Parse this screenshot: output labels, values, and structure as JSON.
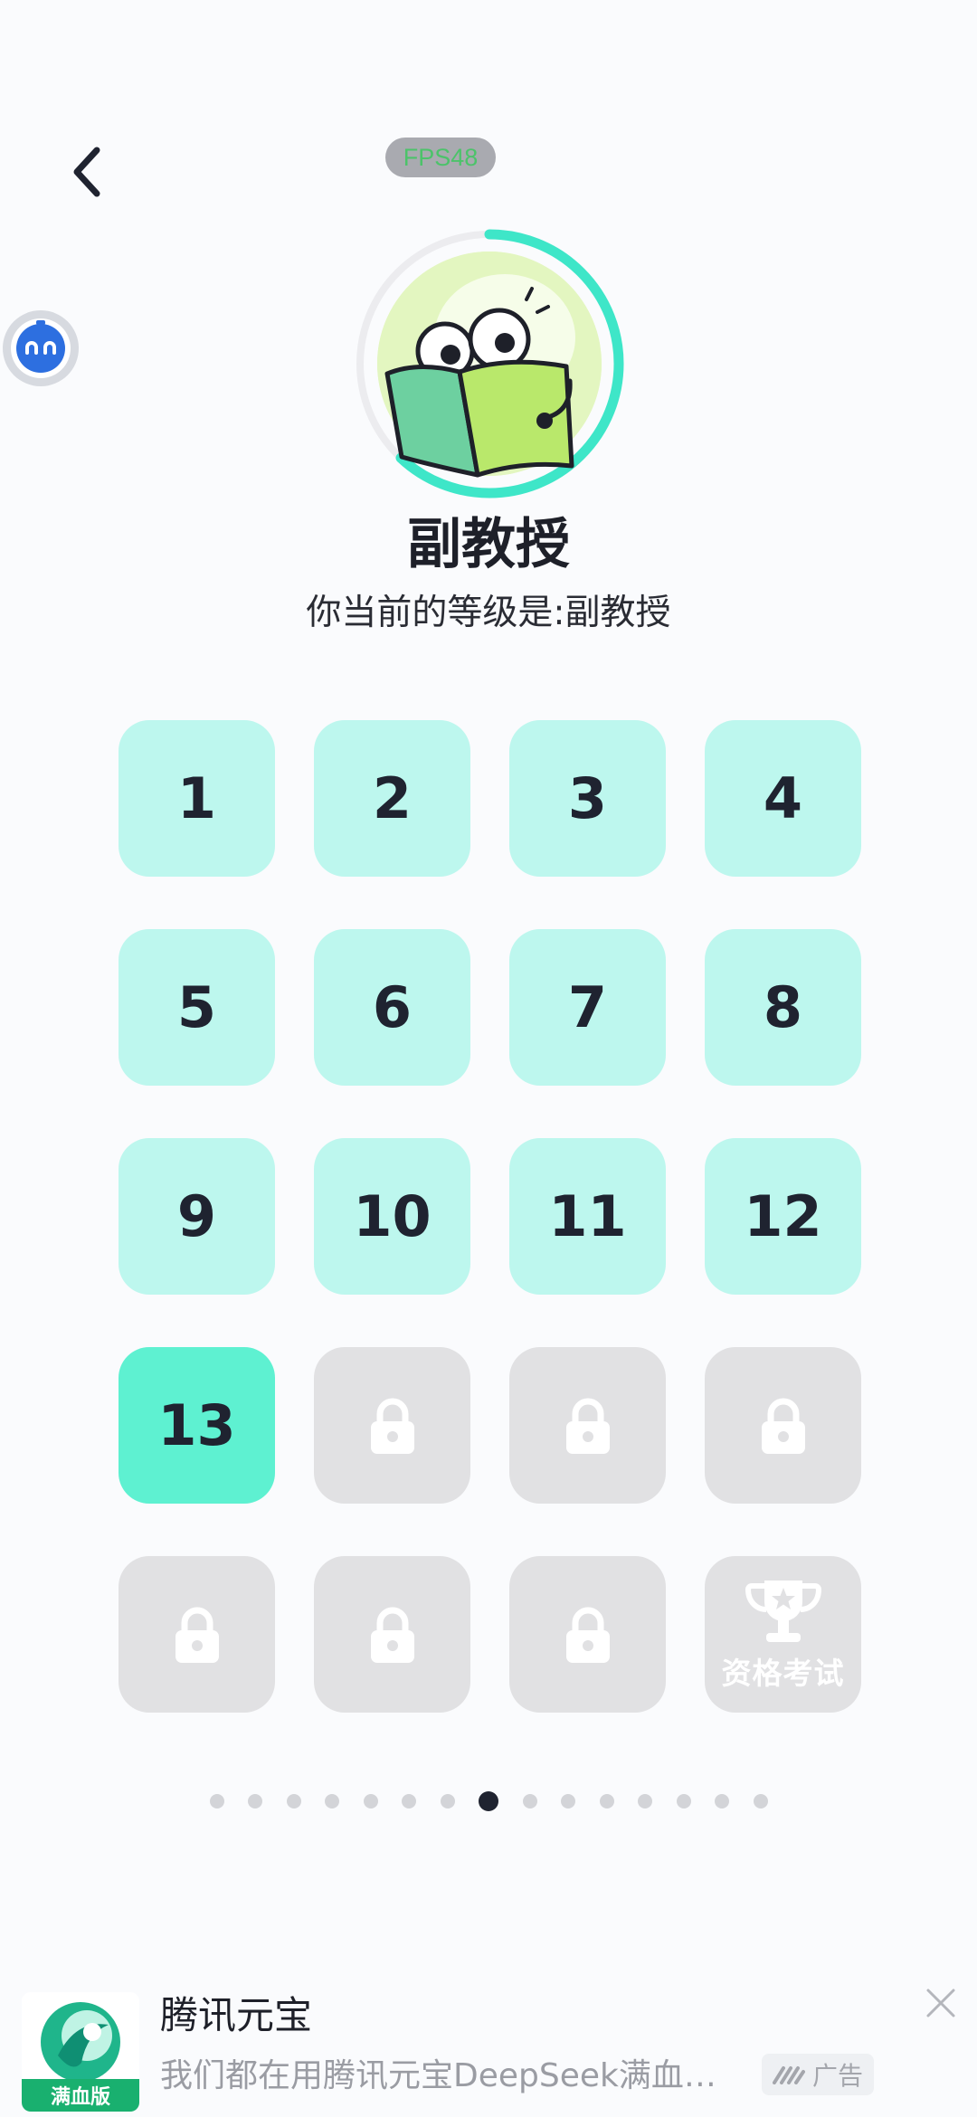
{
  "topbar": {
    "back_icon": "chevron-left-icon",
    "fps_label": "FPS48"
  },
  "assistant": {
    "icon": "robot-face-icon"
  },
  "profile": {
    "avatar_icon": "reading-frog-mascot",
    "progress_fraction": 0.62,
    "ring_color": "#3ee6c8",
    "level_name": "副教授",
    "level_description": "你当前的等级是:副教授"
  },
  "levels": {
    "tiles": [
      {
        "label": "1",
        "state": "done"
      },
      {
        "label": "2",
        "state": "done"
      },
      {
        "label": "3",
        "state": "done"
      },
      {
        "label": "4",
        "state": "done"
      },
      {
        "label": "5",
        "state": "done"
      },
      {
        "label": "6",
        "state": "done"
      },
      {
        "label": "7",
        "state": "done"
      },
      {
        "label": "8",
        "state": "done"
      },
      {
        "label": "9",
        "state": "done"
      },
      {
        "label": "10",
        "state": "done"
      },
      {
        "label": "11",
        "state": "done"
      },
      {
        "label": "12",
        "state": "done"
      },
      {
        "label": "13",
        "state": "current"
      },
      {
        "label": "",
        "state": "locked"
      },
      {
        "label": "",
        "state": "locked"
      },
      {
        "label": "",
        "state": "locked"
      },
      {
        "label": "",
        "state": "locked"
      },
      {
        "label": "",
        "state": "locked"
      },
      {
        "label": "",
        "state": "locked"
      },
      {
        "label": "资格考试",
        "state": "exam"
      }
    ],
    "colors": {
      "done": "#bdf7ee",
      "current": "#5ef1d1",
      "locked": "#e1e1e3"
    }
  },
  "pager": {
    "total_pages": 15,
    "active_page": 8
  },
  "ad": {
    "title": "腾讯元宝",
    "description": "我们都在用腾讯元宝DeepSeek满血版...",
    "logo_badge": "满血版",
    "tag_label": "广告",
    "close_icon": "close-icon"
  }
}
